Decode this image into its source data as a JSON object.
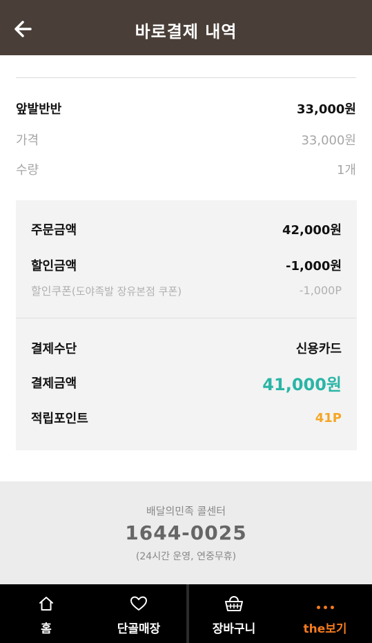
{
  "header": {
    "title": "바로결제 내역"
  },
  "item": {
    "name": "앞발반반",
    "total": "33,000원",
    "price_label": "가격",
    "price_value": "33,000원",
    "qty_label": "수량",
    "qty_value": "1개"
  },
  "summary": {
    "order_label": "주문금액",
    "order_value": "42,000원",
    "discount_label": "할인금액",
    "discount_value": "-1,000원",
    "coupon_label": "할인쿠폰",
    "coupon_detail": "(도야족발 장유본점 쿠폰)",
    "coupon_value": "-1,000P",
    "method_label": "결제수단",
    "method_value": "신용카드",
    "pay_label": "결제금액",
    "pay_value": "41,000원",
    "point_label": "적립포인트",
    "point_value": "41P"
  },
  "callcenter": {
    "label": "배달의민족 콜센터",
    "number": "1644-0025",
    "hours": "(24시간 운영, 연중무휴)"
  },
  "tabs": {
    "home": "홈",
    "favorites": "단골매장",
    "cart": "장바구니",
    "more": "the보기"
  },
  "colors": {
    "header_bg": "#4a3f38",
    "pay_amount": "#2ab5a6",
    "point": "#f5a623",
    "more_tab": "#f47a20"
  },
  "icons": {
    "back": "arrow-left-icon",
    "home": "home-icon",
    "favorites": "heart-icon",
    "cart": "basket-icon",
    "more": "more-dots-icon"
  }
}
